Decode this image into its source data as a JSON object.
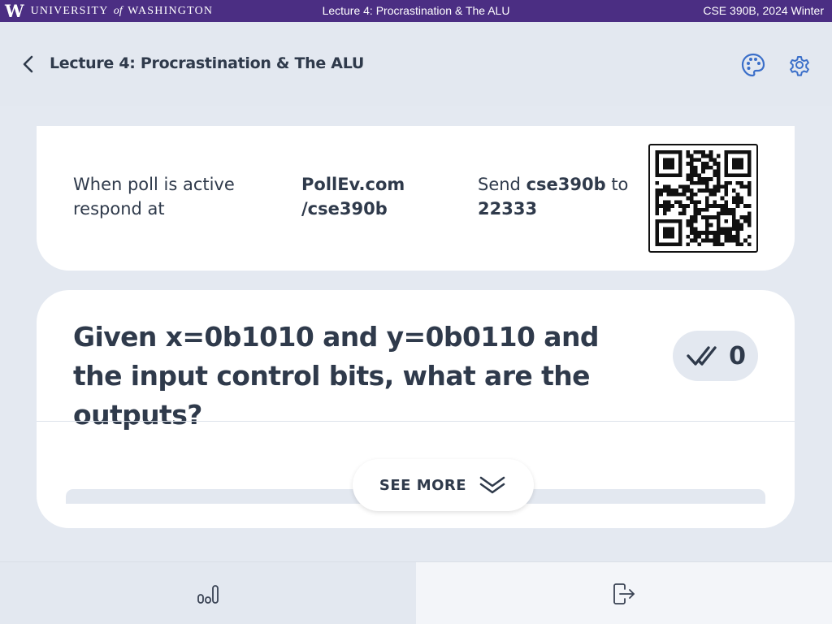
{
  "banner": {
    "logo_letter": "W",
    "university_part1": "UNIVERSITY",
    "university_of": "of",
    "university_part2": "WASHINGTON",
    "center_title": "Lecture 4: Procrastination & The ALU",
    "right_text": "CSE 390B, 2024 Winter",
    "color": "#4b2e83"
  },
  "header": {
    "title": "Lecture 4: Procrastination & The ALU",
    "back_icon": "chevron-left-icon",
    "palette_icon": "palette-icon",
    "settings_icon": "gear-icon",
    "accent": "#3b6fc9"
  },
  "poll_info": {
    "instruction_line1": "When poll is active",
    "instruction_line2": "respond at",
    "site_line1": "PollEv.com",
    "site_line2": "/cse390b",
    "sms_prefix": "Send ",
    "sms_code": "cse390b",
    "sms_suffix": " to",
    "sms_number": "22333",
    "qr_icon": "qr-code-icon"
  },
  "question": {
    "text": "Given x=0b1010 and y=0b0110 and the input control bits, what are the outputs?",
    "response_count": "0",
    "response_icon": "double-check-icon",
    "see_more_label": "SEE MORE",
    "see_more_icon": "double-chevron-down-icon"
  },
  "bottom_nav": {
    "results_icon": "bar-chart-icon",
    "exit_icon": "exit-icon"
  }
}
